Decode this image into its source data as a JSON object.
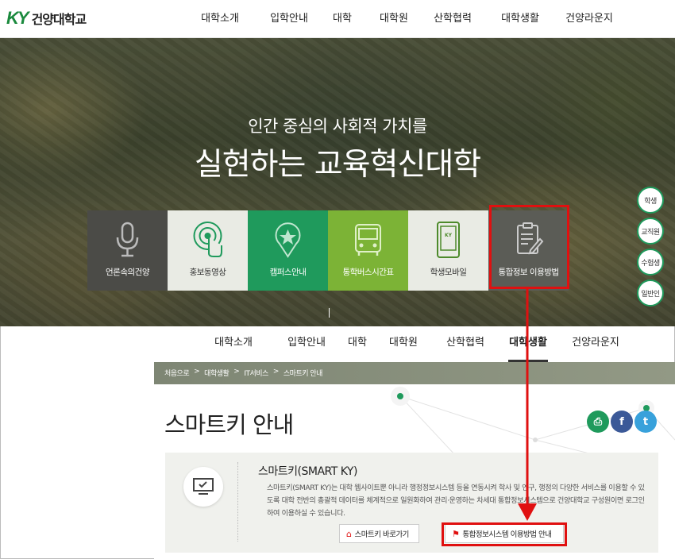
{
  "header": {
    "logo_mark": "KY",
    "logo_text": "건양대학교",
    "nav": [
      "대학소개",
      "입학안내",
      "대학",
      "대학원",
      "산학협력",
      "대학생활",
      "건양라운지"
    ]
  },
  "hero": {
    "subtitle": "인간 중심의 사회적 가치를",
    "title": "실현하는 교육혁신대학",
    "tiles": [
      {
        "label": "언론속의건양",
        "icon": "microphone-icon"
      },
      {
        "label": "홍보동영상",
        "icon": "video-touch-icon"
      },
      {
        "label": "캠퍼스안내",
        "icon": "map-pin-star-icon"
      },
      {
        "label": "통학버스시간표",
        "icon": "bus-icon"
      },
      {
        "label": "학생모바일",
        "icon": "mobile-icon"
      },
      {
        "label": "통합정보 이용방법",
        "icon": "clipboard-edit-icon"
      }
    ],
    "quick_links": [
      "학생",
      "교직원",
      "수험생",
      "일반인"
    ]
  },
  "subnav": {
    "items": [
      "대학소개",
      "입학안내",
      "대학",
      "대학원",
      "산학협력",
      "대학생활",
      "건양라운지"
    ],
    "active": "대학생활"
  },
  "breadcrumb": [
    "처음으로",
    "대학생활",
    "IT서비스",
    "스마트키 안내"
  ],
  "page": {
    "title": "스마트키 안내"
  },
  "info": {
    "title": "스마트키(SMART KY)",
    "description": "스마트키(SMART KY)는 대학 웹사이트뿐 아니라 행정정보시스템 등을 연동시켜 학사 및 연구, 행정의 다양한 서비스를 이용할 수 있도록 대학 전반의 총괄적 데이터를 체계적으로 일원화하여 관리·운영하는 차세대 통합정보시스템으로 건양대학교 구성원이면 로그인하여 이용하실 수 있습니다.",
    "button_smart": "스마트키 바로가기",
    "button_guide": "통합정보시스템 이용방법 안내"
  },
  "colors": {
    "brand_green": "#1f9a5c",
    "annotation_red": "#e01010"
  }
}
